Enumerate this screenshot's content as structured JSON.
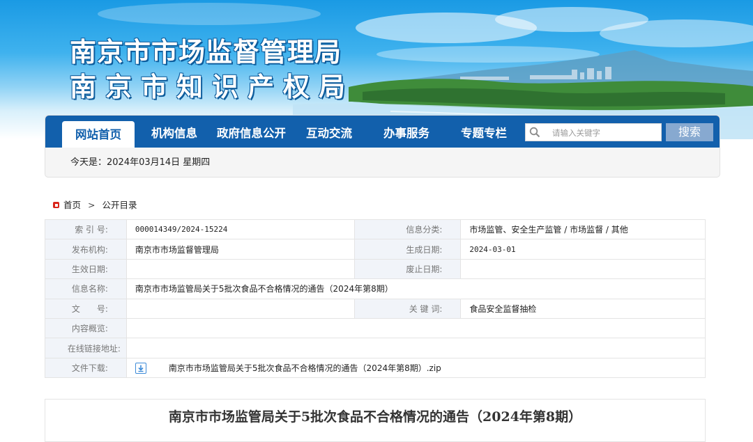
{
  "site": {
    "title_line1": "南京市市场监督管理局",
    "title_line2": "南京市知识产权局"
  },
  "nav": {
    "items": [
      "网站首页",
      "机构信息",
      "政府信息公开",
      "互动交流",
      "办事服务",
      "专题专栏"
    ],
    "active_index": 0,
    "search_placeholder": "请输入关键字",
    "search_button": "搜索"
  },
  "date_text": "今天是：2024年03月14日  星期四",
  "breadcrumb": {
    "home": "首页",
    "separator": ">",
    "current": "公开目录"
  },
  "info": {
    "index_label": "索 引 号:",
    "index_value": "000014349/2024-15224",
    "category_label": "信息分类:",
    "category_value": "市场监管、安全生产监管 / 市场监督 / 其他",
    "publisher_label": "发布机构:",
    "publisher_value": "南京市市场监督管理局",
    "created_label": "生成日期:",
    "created_value": "2024-03-01",
    "effective_label": "生效日期:",
    "effective_value": "",
    "abolished_label": "废止日期:",
    "abolished_value": "",
    "name_label": "信息名称:",
    "name_value": "南京市市场监管局关于5批次食品不合格情况的通告（2024年第8期）",
    "docno_label": "文　　号:",
    "docno_value": "",
    "keywords_label": "关 键 词:",
    "keywords_value": "食品安全监督抽检",
    "summary_label": "内容概览:",
    "summary_value": "",
    "link_label": "在线链接地址:",
    "link_value": "",
    "download_label": "文件下载:",
    "download_file": "南京市市场监管局关于5批次食品不合格情况的通告（2024年第8期）.zip"
  },
  "article": {
    "title": "南京市市场监管局关于5批次食品不合格情况的通告（2024年第8期）"
  },
  "colors": {
    "nav_blue": "#1260ac",
    "search_button": "#87a9d0",
    "label_bg": "#f1f4f9",
    "breadcrumb_icon": "#d9261c"
  }
}
